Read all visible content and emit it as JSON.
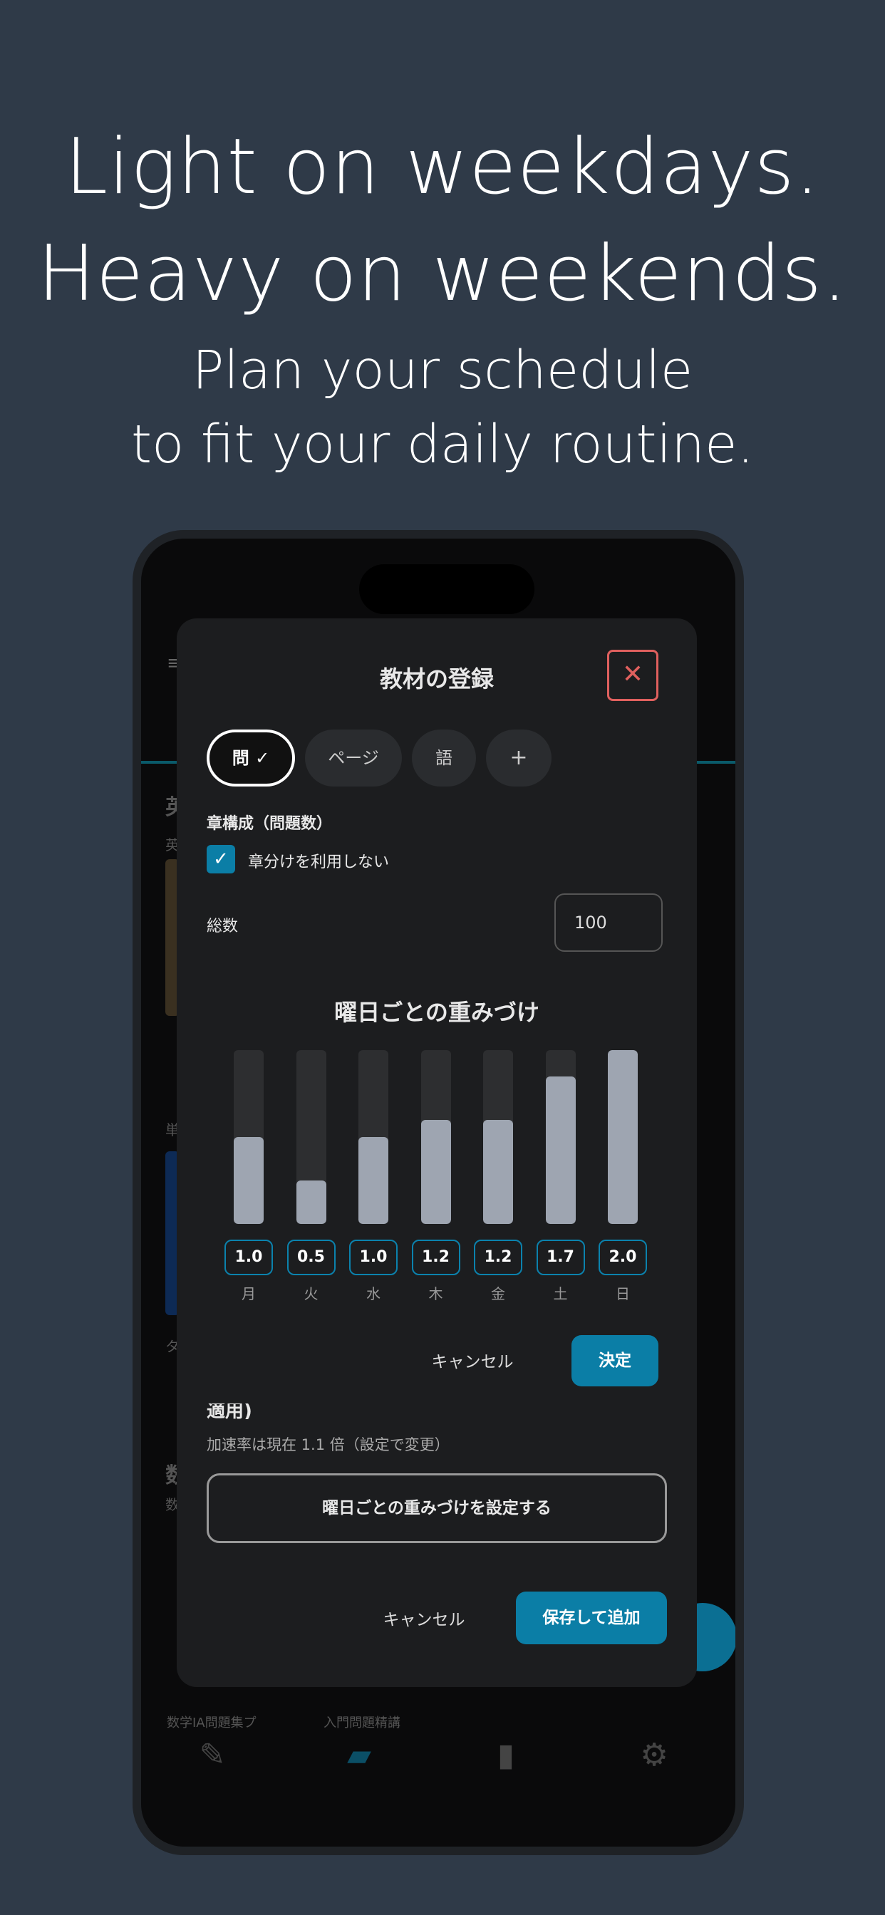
{
  "promo": {
    "headline_line1": "Light on weekdays.",
    "headline_line2": "Heavy on weekends.",
    "sub_line1": "Plan your schedule",
    "sub_line2": "to fit your daily routine."
  },
  "background_app": {
    "menu_icon": "≡",
    "fragments": [
      "英",
      "英",
      "単",
      "タ",
      "数",
      "数",
      "数学IA問題集プ",
      "入門問題精講"
    ],
    "tabs": [
      "pencil-icon",
      "book-icon",
      "bar-chart-icon",
      "gear-icon"
    ]
  },
  "modal": {
    "title": "教材の登録",
    "close_label": "✕",
    "unit_chips": [
      {
        "label": "問 ✓",
        "active": true
      },
      {
        "label": "ページ",
        "active": false
      },
      {
        "label": "語",
        "active": false
      },
      {
        "label": "+",
        "active": false
      }
    ],
    "chapter_label": "章構成（問題数）",
    "checkbox_label": "章分けを利用しない",
    "checkbox_checked": true,
    "total_label": "総数",
    "total_value": "100",
    "weight_section": {
      "title": "曜日ごとの重みづけ",
      "max_value": 2.0,
      "days": [
        {
          "label": "月",
          "value": 1.0,
          "display": "1.0"
        },
        {
          "label": "火",
          "value": 0.5,
          "display": "0.5"
        },
        {
          "label": "水",
          "value": 1.0,
          "display": "1.0"
        },
        {
          "label": "木",
          "value": 1.2,
          "display": "1.2"
        },
        {
          "label": "金",
          "value": 1.2,
          "display": "1.2"
        },
        {
          "label": "土",
          "value": 1.7,
          "display": "1.7"
        },
        {
          "label": "日",
          "value": 2.0,
          "display": "2.0"
        }
      ],
      "cancel_label": "キャンセル",
      "confirm_label": "決定"
    },
    "cut_heading": "適用)",
    "accel_note": "加速率は現在 1.1 倍（設定で変更）",
    "set_weight_button": "曜日ごとの重みづけを設定する",
    "cancel_label": "キャンセル",
    "save_label": "保存して追加"
  },
  "colors": {
    "background": "#2f3a48",
    "accent": "#0b7ea6",
    "close": "#e0605e",
    "bar_fill": "#9ea5b1"
  }
}
